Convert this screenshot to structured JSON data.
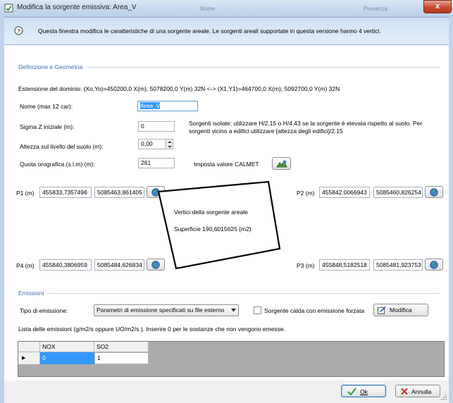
{
  "window": {
    "title": "Modifica la sorgente emissiva: Area_V",
    "close_glyph": "x",
    "bg_tab_left": "Nome",
    "bg_tab_right": "Presenza"
  },
  "info": {
    "icon": "info-icon",
    "text": "Questa finestra modifica le caratteristiche di una sorgente areale. Le sorgenti areali supportate in questa versione hanno 4 vertici."
  },
  "geometry": {
    "section_title": "Definizione e Geometria",
    "domain_extent": "Estensione del dominio: (Xo,Yo)=450200,0 X(m); 5078200,0 Y(m) 32N  <-> (X1,Y1)=464700,0 X(m); 5092700,0 Y(m) 32N",
    "name_label": "Nome (max 12 car):",
    "name_value": "Area_V",
    "sigma_label": "Sigma Z iniziale (m):",
    "sigma_value": "0",
    "sigma_hint": "Sorgenti isolate: utilizzare H/2.15 o H/4.43 se la sorgente è elevata rispetto al suolo. Per sorgenti vicino a edifici utilizzare [altezza degli edifici]/2.15",
    "height_label": "Altezza sul livello del suolo (m):",
    "height_value": "0,00",
    "quota_label": "Quota orografica (s.l.m)  (m):",
    "quota_value": "261",
    "calmet_label": "Imposta valore CALMET",
    "p1": {
      "label": "P1 (m)",
      "x": "455833,7357496",
      "y": "5085463,861405"
    },
    "p2": {
      "label": "P2 (m)",
      "x": "455842,0066943",
      "y": "5085460,826254"
    },
    "p3": {
      "label": "P3 (m)",
      "x": "455848,5182518",
      "y": "5085481,923753"
    },
    "p4": {
      "label": "P4 (m)",
      "x": "455840,3806959",
      "y": "5085484,626834"
    },
    "vertices_title": "Vertici della sorgente areale",
    "surface_text": "Superficie  190,6015625 (m2)"
  },
  "emissions": {
    "section_title": "Emissioni",
    "type_label": "Tipo di emissione:",
    "type_value": "Parametri di emissione specificati su file esterno",
    "hot_source_label": "Sorgente calda con emissione forzata",
    "hot_source_checked": false,
    "modify_label": "Modifica",
    "list_label": "Lista delle emissioni (g/m2/s oppure UO/m2/s ). Inserire 0 per le sostanze che non vengono emesse.",
    "columns": [
      "NOX",
      "SO2"
    ],
    "rows": [
      [
        "0",
        "1"
      ]
    ],
    "row_marker": "▶"
  },
  "footer": {
    "ok_label": "Ok",
    "cancel_label": "Annulla"
  },
  "colors": {
    "accent": "#3c6fb3",
    "selected_cell": "#3399ff",
    "grid_bg": "#ababab"
  }
}
